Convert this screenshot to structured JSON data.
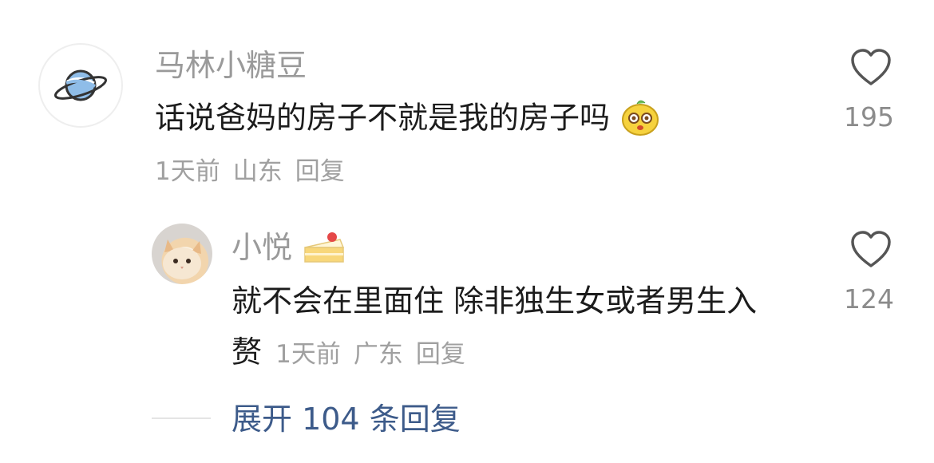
{
  "comment": {
    "username": "马林小糖豆",
    "text": "话说爸妈的房子不就是我的房子吗",
    "time": "1天前",
    "location": "山东",
    "reply_label": "回复",
    "likes": "195",
    "avatar_icon": "planet-icon",
    "emoji_icon": "yellow-chick-emoji"
  },
  "reply": {
    "username": "小悦",
    "username_emoji": "cake-emoji",
    "text_line1": "就不会在里面住 除非独生女或者男生入",
    "text_line2": "赘",
    "time": "1天前",
    "location": "广东",
    "reply_label": "回复",
    "likes": "124",
    "avatar_icon": "cat-avatar"
  },
  "expand": {
    "label": "展开 104 条回复"
  },
  "colors": {
    "link": "#3d5b8a",
    "secondary": "#9a9a9a",
    "primary_text": "#1c1c1c"
  }
}
